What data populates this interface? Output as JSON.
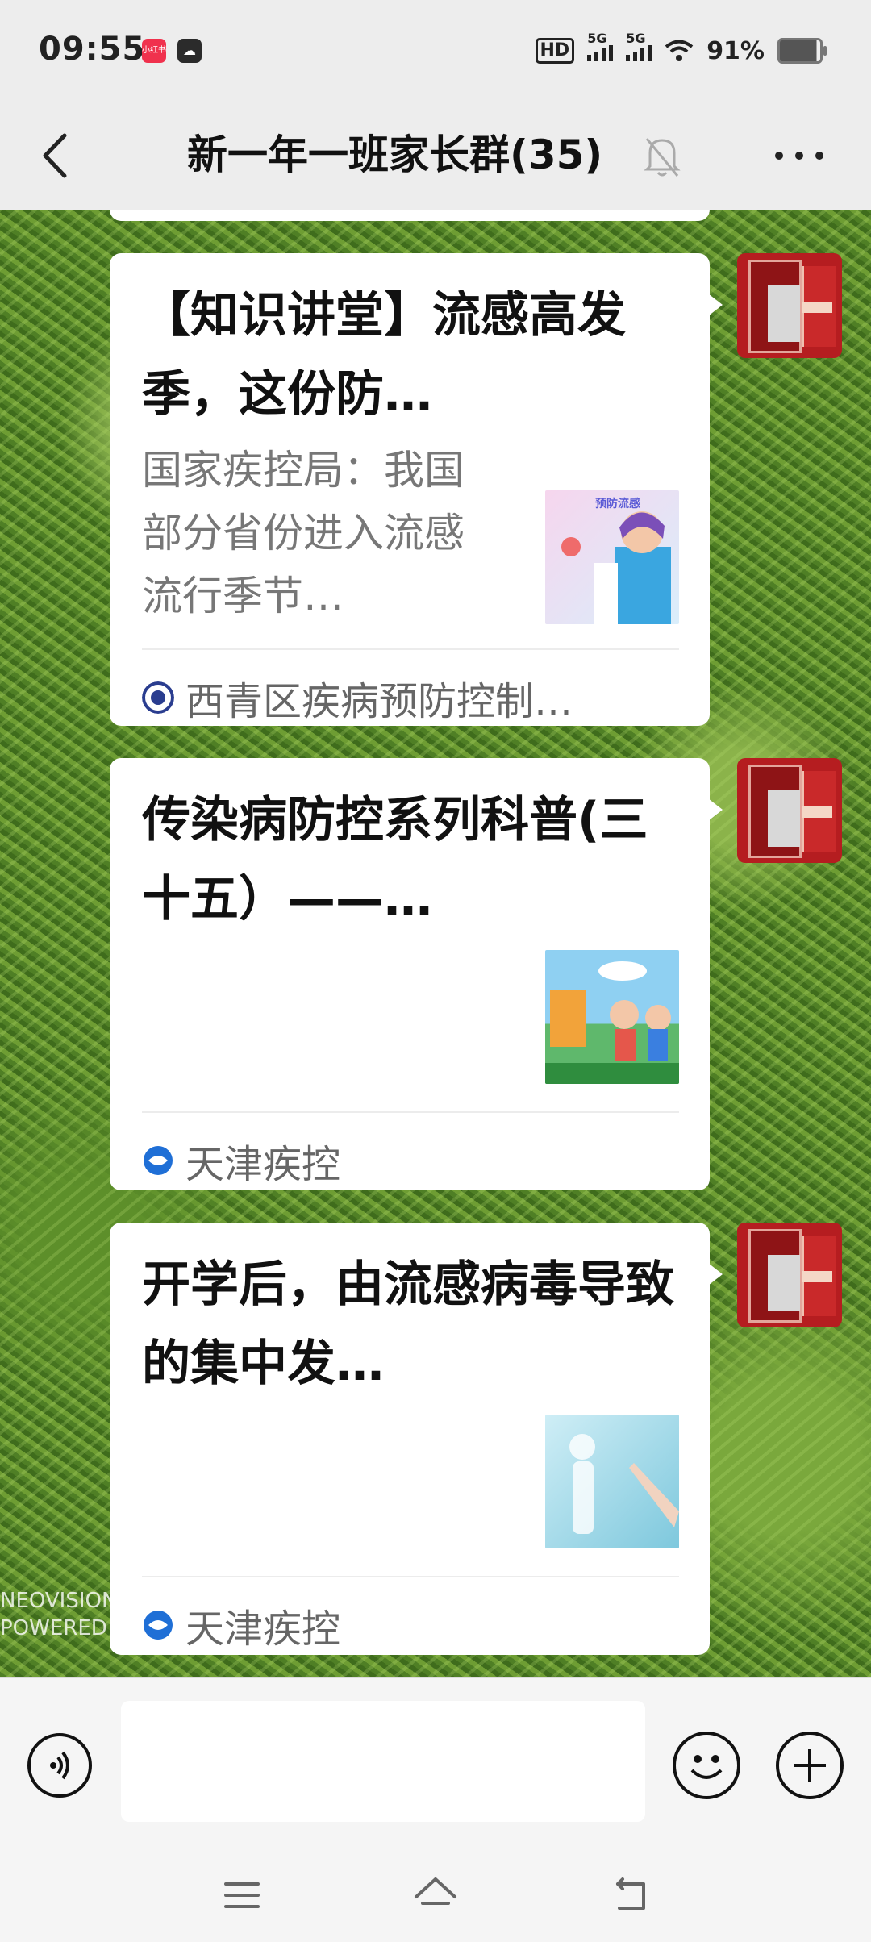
{
  "status_bar": {
    "time": "09:55",
    "app_icon_1": "小红书",
    "network_1": "5G",
    "network_2": "5G",
    "hd_label": "HD",
    "battery": "91%"
  },
  "header": {
    "title": "新一年一班家长群(35)",
    "back_icon": "chevron-left-icon",
    "mute_icon": "bell-off-icon",
    "more_icon": "more-icon"
  },
  "messages": [
    {
      "title": "【知识讲堂】流感高发季，这份防…",
      "description": "国家疾控局：我国部分省份进入流感流行季节…",
      "thumbnail_label": "预防流感",
      "source": "西青区疾病预防控制…"
    },
    {
      "title": "传染病防控系列科普(三十五）——…",
      "description": "",
      "source": "天津疾控"
    },
    {
      "title": "开学后，由流感病毒导致的集中发…",
      "description": "",
      "source": "天津疾控"
    }
  ],
  "watermark": [
    "NEOVISION",
    "POWERED"
  ],
  "input_bar": {
    "voice_icon": "voice-icon",
    "emoji_icon": "emoji-icon",
    "plus_icon": "plus-icon"
  },
  "colors": {
    "accent_red": "#b51d20",
    "bubble_bg": "#ffffff",
    "bar_bg": "#ededed"
  }
}
